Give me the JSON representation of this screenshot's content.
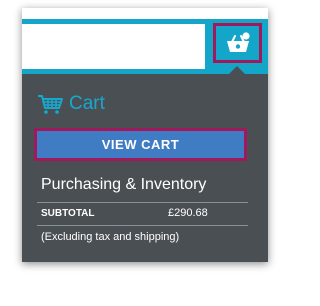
{
  "search": {
    "value": "",
    "placeholder": ""
  },
  "header": {
    "cart_icon": "basket-icon"
  },
  "cart_panel": {
    "heading_icon": "basket-icon",
    "heading": "Cart",
    "view_cart_label": "VIEW CART",
    "company": "Purchasing & Inventory",
    "subtotal_label": "SUBTOTAL",
    "subtotal_value": "£290.68",
    "tax_note": "(Excluding tax and shipping)"
  },
  "colors": {
    "topbar": "#14a6c9",
    "panel": "#4a4f54",
    "accent_blue": "#3f7cc3",
    "highlight_border": "#a2195b",
    "cart_heading": "#17a8d0"
  }
}
